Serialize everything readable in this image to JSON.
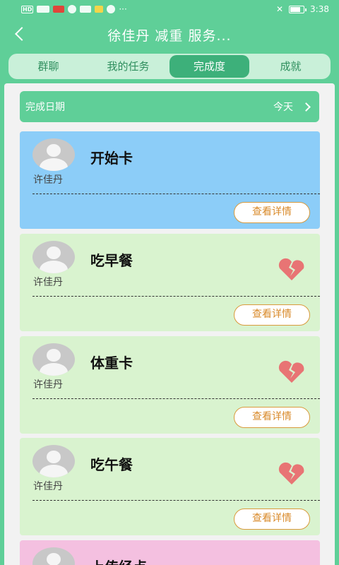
{
  "status_bar": {
    "network": "HD",
    "time": "3:38"
  },
  "header": {
    "title": "徐佳丹 减重 服务..."
  },
  "tabs": [
    {
      "label": "群聊",
      "active": false
    },
    {
      "label": "我的任务",
      "active": false
    },
    {
      "label": "完成度",
      "active": true
    },
    {
      "label": "成就",
      "active": false
    }
  ],
  "date_bar": {
    "label": "完成日期",
    "value": "今天"
  },
  "cards": [
    {
      "title": "开始卡",
      "user": "许佳丹",
      "button": "查看详情",
      "color": "#8ccdf8",
      "broken_heart": false
    },
    {
      "title": "吃早餐",
      "user": "许佳丹",
      "button": "查看详情",
      "color": "#d9f3cf",
      "broken_heart": true
    },
    {
      "title": "体重卡",
      "user": "许佳丹",
      "button": "查看详情",
      "color": "#d9f3cf",
      "broken_heart": true
    },
    {
      "title": "吃午餐",
      "user": "许佳丹",
      "button": "查看详情",
      "color": "#d9f3cf",
      "broken_heart": true
    },
    {
      "title": "上传经点",
      "user": "",
      "button": "",
      "color": "#f4c0e0",
      "broken_heart": false
    }
  ],
  "colors": {
    "brand": "#5fcf98",
    "heart": "#e87474",
    "button_border": "#d99a3c"
  }
}
